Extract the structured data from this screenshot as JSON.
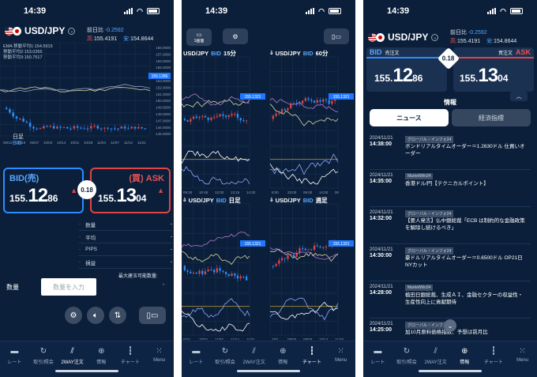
{
  "status": {
    "time": "14:39"
  },
  "tabs": [
    "レート",
    "取引/照会",
    "2WAY注文",
    "情報",
    "チャート",
    "Menu"
  ],
  "pair": "USD/JPY",
  "panel1": {
    "prev_label": "前日比",
    "prev_value": "-0.2592",
    "high_label": "高:",
    "high_value": "155.4191",
    "low_label": "安:",
    "low_value": "154.8644",
    "ema_label": "EMA 移動平均1:154.5915",
    "ma2_label": "移動平均2:153.0265",
    "ma3_label": "移動平均3:150.7517",
    "tf_label": "日足",
    "side_label": "BID",
    "price_tag": "155.1286",
    "y_ticks": [
      "158.0000",
      "157.0000",
      "156.0000",
      "155.0000",
      "154.0000",
      "153.0000",
      "152.0000",
      "151.0000",
      "150.0000",
      "149.0000",
      "148.0000",
      "147.0000",
      "146.0000",
      "145.0000"
    ],
    "x_ticks": [
      "09/12",
      "09/19",
      "09/27",
      "10/04",
      "10/14",
      "10/21",
      "10/28",
      "11/04",
      "11/07",
      "11/14",
      "11/21"
    ],
    "bid_label": "BID(売)",
    "ask_label": "(買) ASK",
    "bid_small": "155.",
    "bid_big": "12",
    "bid_tail": "86",
    "ask_small": "155.",
    "ask_big": "13",
    "ask_tail": "04",
    "spread": "0.18",
    "rows": [
      {
        "label": "数量",
        "value": "-"
      },
      {
        "label": "平均",
        "value": "-"
      },
      {
        "label": "PIPS",
        "value": "-"
      },
      {
        "label": "損益",
        "value": "-"
      }
    ],
    "max_label": "最大建玉可能数量:",
    "max_value": "-",
    "qty_label": "数量",
    "qty_placeholder": "数量を入力"
  },
  "panel2": {
    "top_btn": "1画面",
    "charts": [
      {
        "title": "USD/JPY",
        "side": "BID",
        "tf": "15分",
        "tag": "155.1321",
        "x": [
          "09:30",
          "10:45",
          "12:00",
          "13:15",
          "14:30"
        ]
      },
      {
        "title": "USD/JPY",
        "side": "BID",
        "tf": "60分",
        "tag": "155.1321",
        "x": [
          "8:00",
          "23:00",
          "06:00",
          "14:00",
          "00"
        ]
      },
      {
        "title": "USD/JPY",
        "side": "BID",
        "tf": "日足",
        "tag": "155.1321",
        "x": [
          "0/24",
          "10/31",
          "11/07",
          "11/14",
          "11/21"
        ]
      },
      {
        "title": "USD/JPY",
        "side": "BID",
        "tf": "週足",
        "tag": "155.1321",
        "x": [
          "7/01",
          "08/05",
          "09/09",
          "10/14",
          "11/18"
        ]
      }
    ]
  },
  "panel3": {
    "prev_label": "前日比",
    "prev_value": "-0.2592",
    "high_label": "高:",
    "high_value": "155.4191",
    "low_label": "安:",
    "low_value": "154.8644",
    "bid_label": "BID",
    "bid_sub": "売注文",
    "ask_label": "ASK",
    "ask_sub": "買注文",
    "bid_small": "155.",
    "bid_big": "12",
    "bid_tail": "86",
    "ask_small": "155.",
    "ask_big": "13",
    "ask_tail": "04",
    "spread": "0.18",
    "info_title": "情報",
    "seg_news": "ニュース",
    "seg_econ": "経済指標",
    "news": [
      {
        "date": "2024/11/21",
        "time": "14:38:00",
        "src": "グローバル・インフォ24",
        "title": "ボンドリアルタイムオーダー＝1.2630ドル 仕買いオーダー"
      },
      {
        "date": "2024/11/21",
        "time": "14:35:00",
        "src": "MarketWin24",
        "title": "香港ドル/円【テクニカルポイント】"
      },
      {
        "date": "2024/11/21",
        "time": "14:32:00",
        "src": "グローバル・インフォ24",
        "title": "【要人発言】仏中銀総裁「ECB は制約的な金融政策を解除し続けるべき」"
      },
      {
        "date": "2024/11/21",
        "time": "14:30:00",
        "src": "グローバル・インフォ24",
        "title": "豪ドルリアルタイムオーダー＝0.6500ドル OP21日NYカット"
      },
      {
        "date": "2024/11/21",
        "time": "14:28:00",
        "src": "MarketWin24",
        "title": "植田日銀総裁、生成ＡＩ、金融セクターの収益性・生産性向上に貢献期待"
      },
      {
        "date": "2024/11/21",
        "time": "14:25:00",
        "src": "グローバル・インフォ24",
        "title": "加10月原料価格指数、予想は前月比"
      }
    ]
  }
}
